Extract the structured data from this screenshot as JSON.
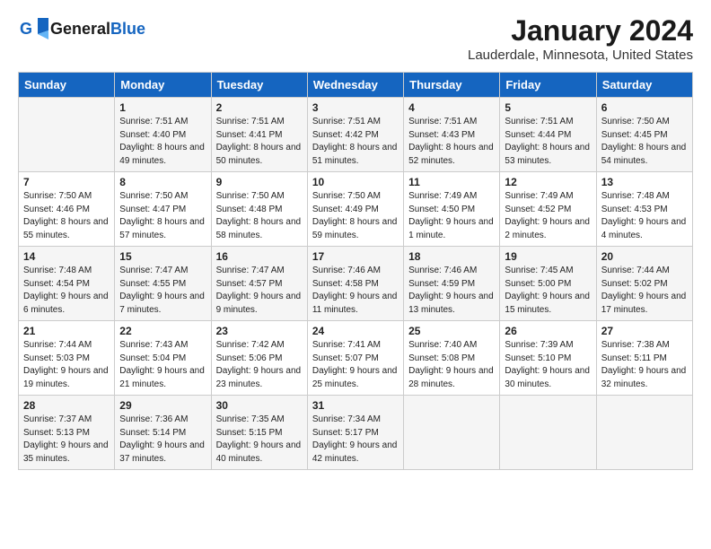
{
  "header": {
    "logo_general": "General",
    "logo_blue": "Blue",
    "cal_title": "January 2024",
    "cal_subtitle": "Lauderdale, Minnesota, United States"
  },
  "days_of_week": [
    "Sunday",
    "Monday",
    "Tuesday",
    "Wednesday",
    "Thursday",
    "Friday",
    "Saturday"
  ],
  "weeks": [
    [
      {
        "day": "",
        "sunrise": "",
        "sunset": "",
        "daylight": ""
      },
      {
        "day": "1",
        "sunrise": "Sunrise: 7:51 AM",
        "sunset": "Sunset: 4:40 PM",
        "daylight": "Daylight: 8 hours and 49 minutes."
      },
      {
        "day": "2",
        "sunrise": "Sunrise: 7:51 AM",
        "sunset": "Sunset: 4:41 PM",
        "daylight": "Daylight: 8 hours and 50 minutes."
      },
      {
        "day": "3",
        "sunrise": "Sunrise: 7:51 AM",
        "sunset": "Sunset: 4:42 PM",
        "daylight": "Daylight: 8 hours and 51 minutes."
      },
      {
        "day": "4",
        "sunrise": "Sunrise: 7:51 AM",
        "sunset": "Sunset: 4:43 PM",
        "daylight": "Daylight: 8 hours and 52 minutes."
      },
      {
        "day": "5",
        "sunrise": "Sunrise: 7:51 AM",
        "sunset": "Sunset: 4:44 PM",
        "daylight": "Daylight: 8 hours and 53 minutes."
      },
      {
        "day": "6",
        "sunrise": "Sunrise: 7:50 AM",
        "sunset": "Sunset: 4:45 PM",
        "daylight": "Daylight: 8 hours and 54 minutes."
      }
    ],
    [
      {
        "day": "7",
        "sunrise": "Sunrise: 7:50 AM",
        "sunset": "Sunset: 4:46 PM",
        "daylight": "Daylight: 8 hours and 55 minutes."
      },
      {
        "day": "8",
        "sunrise": "Sunrise: 7:50 AM",
        "sunset": "Sunset: 4:47 PM",
        "daylight": "Daylight: 8 hours and 57 minutes."
      },
      {
        "day": "9",
        "sunrise": "Sunrise: 7:50 AM",
        "sunset": "Sunset: 4:48 PM",
        "daylight": "Daylight: 8 hours and 58 minutes."
      },
      {
        "day": "10",
        "sunrise": "Sunrise: 7:50 AM",
        "sunset": "Sunset: 4:49 PM",
        "daylight": "Daylight: 8 hours and 59 minutes."
      },
      {
        "day": "11",
        "sunrise": "Sunrise: 7:49 AM",
        "sunset": "Sunset: 4:50 PM",
        "daylight": "Daylight: 9 hours and 1 minute."
      },
      {
        "day": "12",
        "sunrise": "Sunrise: 7:49 AM",
        "sunset": "Sunset: 4:52 PM",
        "daylight": "Daylight: 9 hours and 2 minutes."
      },
      {
        "day": "13",
        "sunrise": "Sunrise: 7:48 AM",
        "sunset": "Sunset: 4:53 PM",
        "daylight": "Daylight: 9 hours and 4 minutes."
      }
    ],
    [
      {
        "day": "14",
        "sunrise": "Sunrise: 7:48 AM",
        "sunset": "Sunset: 4:54 PM",
        "daylight": "Daylight: 9 hours and 6 minutes."
      },
      {
        "day": "15",
        "sunrise": "Sunrise: 7:47 AM",
        "sunset": "Sunset: 4:55 PM",
        "daylight": "Daylight: 9 hours and 7 minutes."
      },
      {
        "day": "16",
        "sunrise": "Sunrise: 7:47 AM",
        "sunset": "Sunset: 4:57 PM",
        "daylight": "Daylight: 9 hours and 9 minutes."
      },
      {
        "day": "17",
        "sunrise": "Sunrise: 7:46 AM",
        "sunset": "Sunset: 4:58 PM",
        "daylight": "Daylight: 9 hours and 11 minutes."
      },
      {
        "day": "18",
        "sunrise": "Sunrise: 7:46 AM",
        "sunset": "Sunset: 4:59 PM",
        "daylight": "Daylight: 9 hours and 13 minutes."
      },
      {
        "day": "19",
        "sunrise": "Sunrise: 7:45 AM",
        "sunset": "Sunset: 5:00 PM",
        "daylight": "Daylight: 9 hours and 15 minutes."
      },
      {
        "day": "20",
        "sunrise": "Sunrise: 7:44 AM",
        "sunset": "Sunset: 5:02 PM",
        "daylight": "Daylight: 9 hours and 17 minutes."
      }
    ],
    [
      {
        "day": "21",
        "sunrise": "Sunrise: 7:44 AM",
        "sunset": "Sunset: 5:03 PM",
        "daylight": "Daylight: 9 hours and 19 minutes."
      },
      {
        "day": "22",
        "sunrise": "Sunrise: 7:43 AM",
        "sunset": "Sunset: 5:04 PM",
        "daylight": "Daylight: 9 hours and 21 minutes."
      },
      {
        "day": "23",
        "sunrise": "Sunrise: 7:42 AM",
        "sunset": "Sunset: 5:06 PM",
        "daylight": "Daylight: 9 hours and 23 minutes."
      },
      {
        "day": "24",
        "sunrise": "Sunrise: 7:41 AM",
        "sunset": "Sunset: 5:07 PM",
        "daylight": "Daylight: 9 hours and 25 minutes."
      },
      {
        "day": "25",
        "sunrise": "Sunrise: 7:40 AM",
        "sunset": "Sunset: 5:08 PM",
        "daylight": "Daylight: 9 hours and 28 minutes."
      },
      {
        "day": "26",
        "sunrise": "Sunrise: 7:39 AM",
        "sunset": "Sunset: 5:10 PM",
        "daylight": "Daylight: 9 hours and 30 minutes."
      },
      {
        "day": "27",
        "sunrise": "Sunrise: 7:38 AM",
        "sunset": "Sunset: 5:11 PM",
        "daylight": "Daylight: 9 hours and 32 minutes."
      }
    ],
    [
      {
        "day": "28",
        "sunrise": "Sunrise: 7:37 AM",
        "sunset": "Sunset: 5:13 PM",
        "daylight": "Daylight: 9 hours and 35 minutes."
      },
      {
        "day": "29",
        "sunrise": "Sunrise: 7:36 AM",
        "sunset": "Sunset: 5:14 PM",
        "daylight": "Daylight: 9 hours and 37 minutes."
      },
      {
        "day": "30",
        "sunrise": "Sunrise: 7:35 AM",
        "sunset": "Sunset: 5:15 PM",
        "daylight": "Daylight: 9 hours and 40 minutes."
      },
      {
        "day": "31",
        "sunrise": "Sunrise: 7:34 AM",
        "sunset": "Sunset: 5:17 PM",
        "daylight": "Daylight: 9 hours and 42 minutes."
      },
      {
        "day": "",
        "sunrise": "",
        "sunset": "",
        "daylight": ""
      },
      {
        "day": "",
        "sunrise": "",
        "sunset": "",
        "daylight": ""
      },
      {
        "day": "",
        "sunrise": "",
        "sunset": "",
        "daylight": ""
      }
    ]
  ]
}
